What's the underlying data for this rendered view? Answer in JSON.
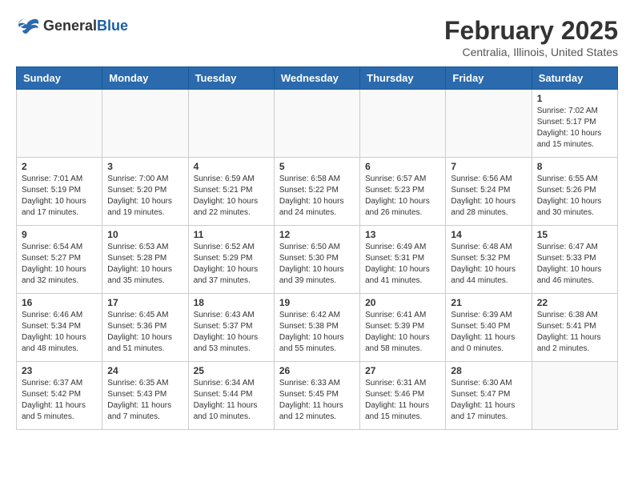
{
  "header": {
    "logo": {
      "general": "General",
      "blue": "Blue"
    },
    "title": "February 2025",
    "subtitle": "Centralia, Illinois, United States"
  },
  "weekdays": [
    "Sunday",
    "Monday",
    "Tuesday",
    "Wednesday",
    "Thursday",
    "Friday",
    "Saturday"
  ],
  "weeks": [
    [
      {
        "day": "",
        "info": ""
      },
      {
        "day": "",
        "info": ""
      },
      {
        "day": "",
        "info": ""
      },
      {
        "day": "",
        "info": ""
      },
      {
        "day": "",
        "info": ""
      },
      {
        "day": "",
        "info": ""
      },
      {
        "day": "1",
        "info": "Sunrise: 7:02 AM\nSunset: 5:17 PM\nDaylight: 10 hours and 15 minutes."
      }
    ],
    [
      {
        "day": "2",
        "info": "Sunrise: 7:01 AM\nSunset: 5:19 PM\nDaylight: 10 hours and 17 minutes."
      },
      {
        "day": "3",
        "info": "Sunrise: 7:00 AM\nSunset: 5:20 PM\nDaylight: 10 hours and 19 minutes."
      },
      {
        "day": "4",
        "info": "Sunrise: 6:59 AM\nSunset: 5:21 PM\nDaylight: 10 hours and 22 minutes."
      },
      {
        "day": "5",
        "info": "Sunrise: 6:58 AM\nSunset: 5:22 PM\nDaylight: 10 hours and 24 minutes."
      },
      {
        "day": "6",
        "info": "Sunrise: 6:57 AM\nSunset: 5:23 PM\nDaylight: 10 hours and 26 minutes."
      },
      {
        "day": "7",
        "info": "Sunrise: 6:56 AM\nSunset: 5:24 PM\nDaylight: 10 hours and 28 minutes."
      },
      {
        "day": "8",
        "info": "Sunrise: 6:55 AM\nSunset: 5:26 PM\nDaylight: 10 hours and 30 minutes."
      }
    ],
    [
      {
        "day": "9",
        "info": "Sunrise: 6:54 AM\nSunset: 5:27 PM\nDaylight: 10 hours and 32 minutes."
      },
      {
        "day": "10",
        "info": "Sunrise: 6:53 AM\nSunset: 5:28 PM\nDaylight: 10 hours and 35 minutes."
      },
      {
        "day": "11",
        "info": "Sunrise: 6:52 AM\nSunset: 5:29 PM\nDaylight: 10 hours and 37 minutes."
      },
      {
        "day": "12",
        "info": "Sunrise: 6:50 AM\nSunset: 5:30 PM\nDaylight: 10 hours and 39 minutes."
      },
      {
        "day": "13",
        "info": "Sunrise: 6:49 AM\nSunset: 5:31 PM\nDaylight: 10 hours and 41 minutes."
      },
      {
        "day": "14",
        "info": "Sunrise: 6:48 AM\nSunset: 5:32 PM\nDaylight: 10 hours and 44 minutes."
      },
      {
        "day": "15",
        "info": "Sunrise: 6:47 AM\nSunset: 5:33 PM\nDaylight: 10 hours and 46 minutes."
      }
    ],
    [
      {
        "day": "16",
        "info": "Sunrise: 6:46 AM\nSunset: 5:34 PM\nDaylight: 10 hours and 48 minutes."
      },
      {
        "day": "17",
        "info": "Sunrise: 6:45 AM\nSunset: 5:36 PM\nDaylight: 10 hours and 51 minutes."
      },
      {
        "day": "18",
        "info": "Sunrise: 6:43 AM\nSunset: 5:37 PM\nDaylight: 10 hours and 53 minutes."
      },
      {
        "day": "19",
        "info": "Sunrise: 6:42 AM\nSunset: 5:38 PM\nDaylight: 10 hours and 55 minutes."
      },
      {
        "day": "20",
        "info": "Sunrise: 6:41 AM\nSunset: 5:39 PM\nDaylight: 10 hours and 58 minutes."
      },
      {
        "day": "21",
        "info": "Sunrise: 6:39 AM\nSunset: 5:40 PM\nDaylight: 11 hours and 0 minutes."
      },
      {
        "day": "22",
        "info": "Sunrise: 6:38 AM\nSunset: 5:41 PM\nDaylight: 11 hours and 2 minutes."
      }
    ],
    [
      {
        "day": "23",
        "info": "Sunrise: 6:37 AM\nSunset: 5:42 PM\nDaylight: 11 hours and 5 minutes."
      },
      {
        "day": "24",
        "info": "Sunrise: 6:35 AM\nSunset: 5:43 PM\nDaylight: 11 hours and 7 minutes."
      },
      {
        "day": "25",
        "info": "Sunrise: 6:34 AM\nSunset: 5:44 PM\nDaylight: 11 hours and 10 minutes."
      },
      {
        "day": "26",
        "info": "Sunrise: 6:33 AM\nSunset: 5:45 PM\nDaylight: 11 hours and 12 minutes."
      },
      {
        "day": "27",
        "info": "Sunrise: 6:31 AM\nSunset: 5:46 PM\nDaylight: 11 hours and 15 minutes."
      },
      {
        "day": "28",
        "info": "Sunrise: 6:30 AM\nSunset: 5:47 PM\nDaylight: 11 hours and 17 minutes."
      },
      {
        "day": "",
        "info": ""
      }
    ]
  ]
}
